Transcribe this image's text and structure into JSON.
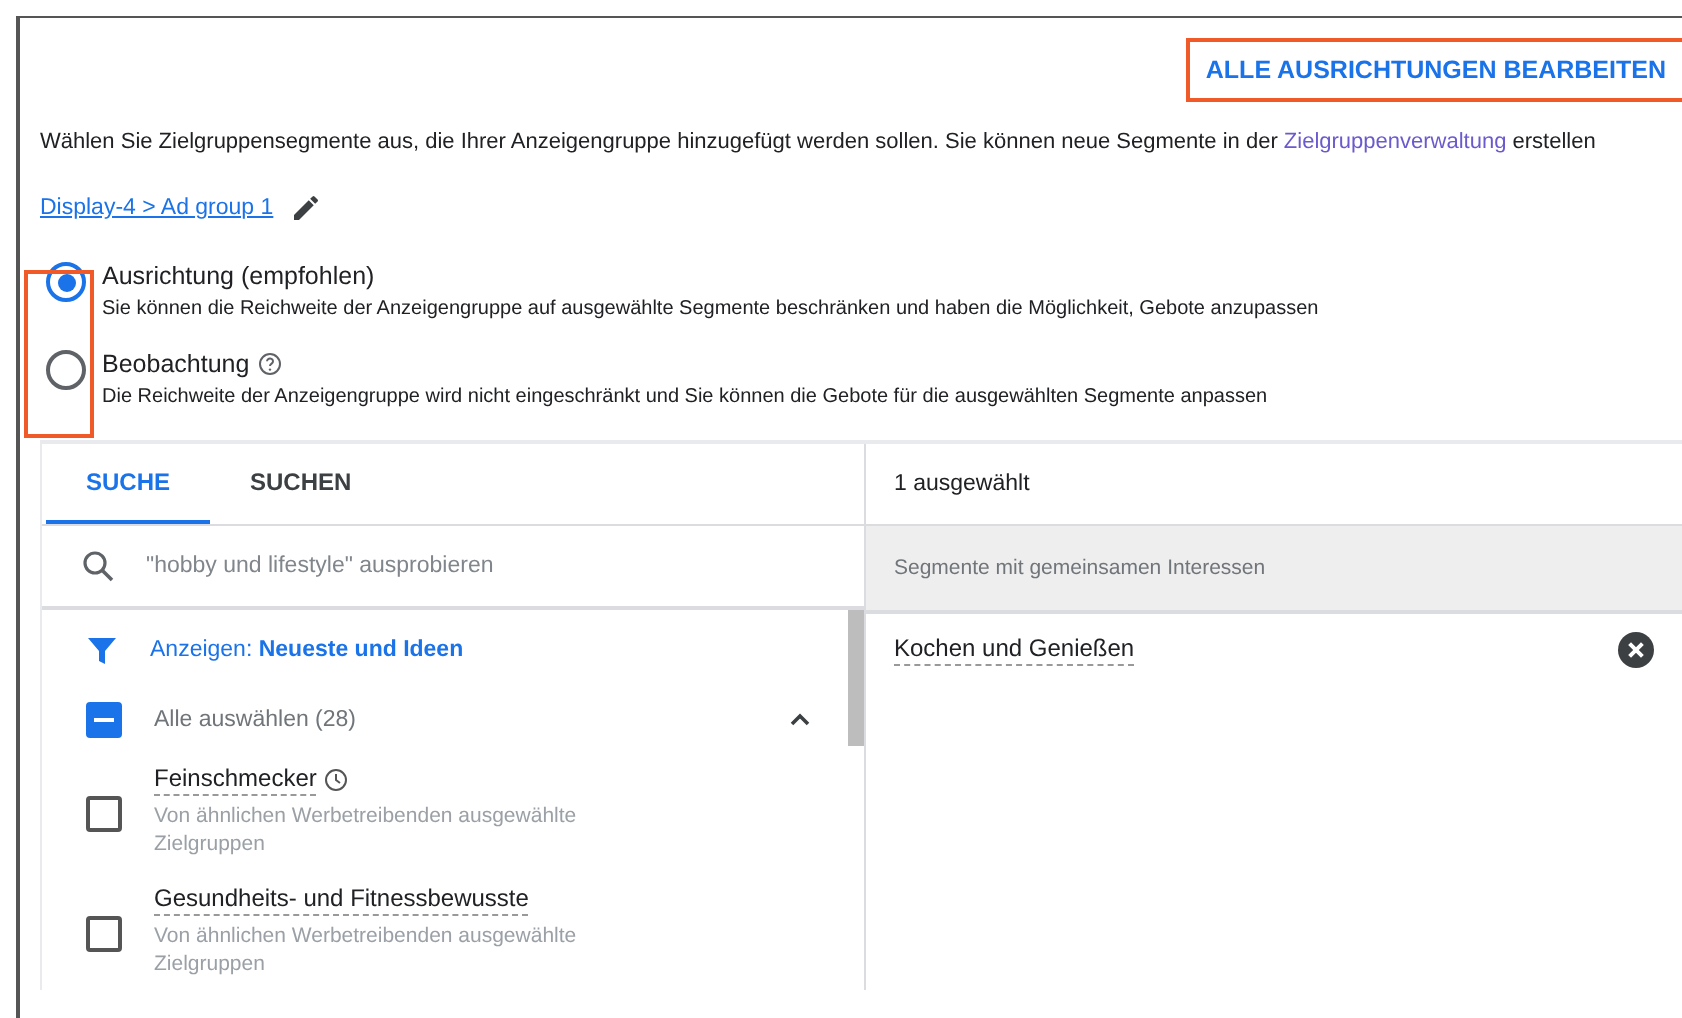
{
  "header_button": {
    "label": "ALLE AUSRICHTUNGEN BEARBEITEN",
    "highlighted": true
  },
  "intro": {
    "text": "Wählen Sie Zielgruppensegmente aus, die Ihrer Anzeigengruppe hinzugefügt werden sollen. Sie können neue Segmente in der ",
    "link": "Zielgruppenverwaltung",
    "tail": " erstellen"
  },
  "breadcrumb": "Display-4 > Ad group 1",
  "options_highlighted": true,
  "options": [
    {
      "label": "Ausrichtung (empfohlen)",
      "description": "Sie können die Reichweite der Anzeigengruppe auf ausgewählte Segmente beschränken und haben die Möglichkeit, Gebote anzupassen",
      "selected": true,
      "help": false
    },
    {
      "label": "Beobachtung",
      "description": "Die Reichweite der Anzeigengruppe wird nicht eingeschränkt und Sie können die Gebote für die ausgewählten Segmente anpassen",
      "selected": false,
      "help": true
    }
  ],
  "tabs": [
    {
      "label": "SUCHE",
      "selected": true
    },
    {
      "label": "SUCHEN",
      "selected": false
    }
  ],
  "search": {
    "placeholder": "\"hobby und lifestyle\" ausprobieren"
  },
  "filter": "Anzeigen: **Neueste und Ideen**",
  "select_all": {
    "label": "Alle auswählen (28)",
    "indeterminate": true,
    "expanded": true
  },
  "segments": [
    {
      "name": "Feinschmecker",
      "subtitle": "Von ähnlichen Werbetreibenden ausgewählte Zielgruppen",
      "checked": false,
      "recent": true
    },
    {
      "name": "Gesundheits- und Fitnessbewusste",
      "subtitle": "Von ähnlichen Werbetreibenden ausgewählte Zielgruppen",
      "checked": false,
      "recent": false
    }
  ],
  "selected_panel": {
    "count": "1 ausgewählt",
    "group": "Segmente mit gemeinsamen Interessen",
    "items": [
      {
        "name": "Kochen und Genießen"
      }
    ]
  }
}
